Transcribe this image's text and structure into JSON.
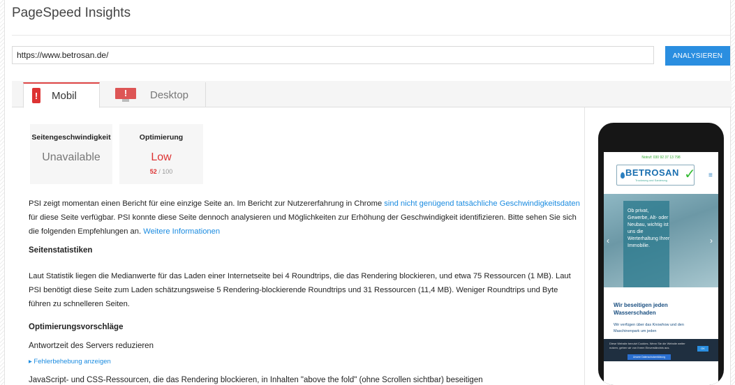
{
  "app": {
    "title": "PageSpeed Insights"
  },
  "search": {
    "url_value": "https://www.betrosan.de/",
    "analyze_label": "ANALYSIEREN"
  },
  "tabs": [
    {
      "label": "Mobil",
      "icon": "phone-alert-icon",
      "active": true
    },
    {
      "label": "Desktop",
      "icon": "monitor-alert-icon",
      "active": false
    }
  ],
  "scores": {
    "speed": {
      "heading": "Seitengeschwindigkeit",
      "value": "Unavailable"
    },
    "optimization": {
      "heading": "Optimierung",
      "value": "Low",
      "score": "52",
      "max": "/ 100",
      "color": "#dd3333"
    }
  },
  "intro": {
    "text1": "PSI zeigt momentan einen Bericht für eine einzige Seite an. Im Bericht zur Nutzererfahrung in Chrome ",
    "link1": "sind nicht genügend tatsächliche Geschwindigkeitsdaten",
    "text2": " für diese Seite verfügbar. PSI konnte diese Seite dennoch analysieren und Möglichkeiten zur Erhöhung der Geschwindigkeit identifizieren. Bitte sehen Sie sich die folgenden Empfehlungen an. ",
    "link2": "Weitere Informationen"
  },
  "stats": {
    "heading": "Seitenstatistiken",
    "text": "Laut Statistik liegen die Medianwerte für das Laden einer Internetseite bei 4 Roundtrips, die das Rendering blockieren, und etwa 75 Ressourcen (1 MB). Laut PSI benötigt diese Seite zum Laden schätzungsweise 5 Rendering-blockierende Roundtrips und 31 Ressourcen (11,4 MB). Weniger Roundtrips und Byte führen zu schnelleren Seiten."
  },
  "optimization": {
    "heading": "Optimierungsvorschläge",
    "rule1": "Antwortzeit des Servers reduzieren",
    "fix_link": "▸ Fehlerbehebung anzeigen",
    "rule2": "JavaScript- und CSS-Ressourcen, die das Rendering blockieren, in Inhalten \"above the fold\" (ohne Scrollen sichtbar) beseitigen"
  },
  "phone_preview": {
    "tel": "Notruf: 030 92 37 13 798",
    "logo": "BETROSAN",
    "logo_sub": "Trocknung und Sanierung",
    "hero_text": "Ob privat, Gewerbe, Alt- oder Neubau, wichtig ist uns die Werterhaltung Ihrer Immobilie.",
    "heading": "Wir beseitigen jeden Wasserschaden",
    "para": "Wir verfügen über das Knowhow und den Maschinenpark um jeden",
    "cookie_text": "Diese Website benutzt Cookies. Wenn Sie die Website weiter nutzen, gehen wir von Ihrem Einverständnis aus.",
    "cookie_ok": "OK",
    "cookie_btn": "Unsere Datenschutzerklärung"
  }
}
